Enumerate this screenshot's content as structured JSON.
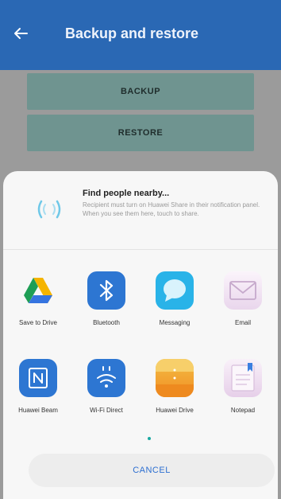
{
  "appbar": {
    "title": "Backup and restore",
    "back_icon": "arrow-left-icon"
  },
  "buttons": {
    "backup": "BACKUP",
    "restore": "RESTORE"
  },
  "share_sheet": {
    "nearby": {
      "title": "Find people nearby...",
      "description": "Recipient must turn on Huawei Share in their notification panel. When you see them here, touch to share.",
      "icon": "nearby-wave-icon"
    },
    "apps": [
      {
        "label": "Save to Drive",
        "icon": "google-drive-icon"
      },
      {
        "label": "Bluetooth",
        "icon": "bluetooth-icon"
      },
      {
        "label": "Messaging",
        "icon": "messaging-icon"
      },
      {
        "label": "Email",
        "icon": "email-icon"
      },
      {
        "label": "Huawei Beam",
        "icon": "nfc-icon"
      },
      {
        "label": "Wi-Fi Direct",
        "icon": "wifi-direct-icon"
      },
      {
        "label": "Huawei Drive",
        "icon": "huawei-drive-icon"
      },
      {
        "label": "Notepad",
        "icon": "notepad-icon"
      }
    ],
    "cancel": "CANCEL"
  },
  "colors": {
    "appbar": "#2a68b4",
    "accent": "#2d6fd1",
    "button": "#6f9490"
  }
}
